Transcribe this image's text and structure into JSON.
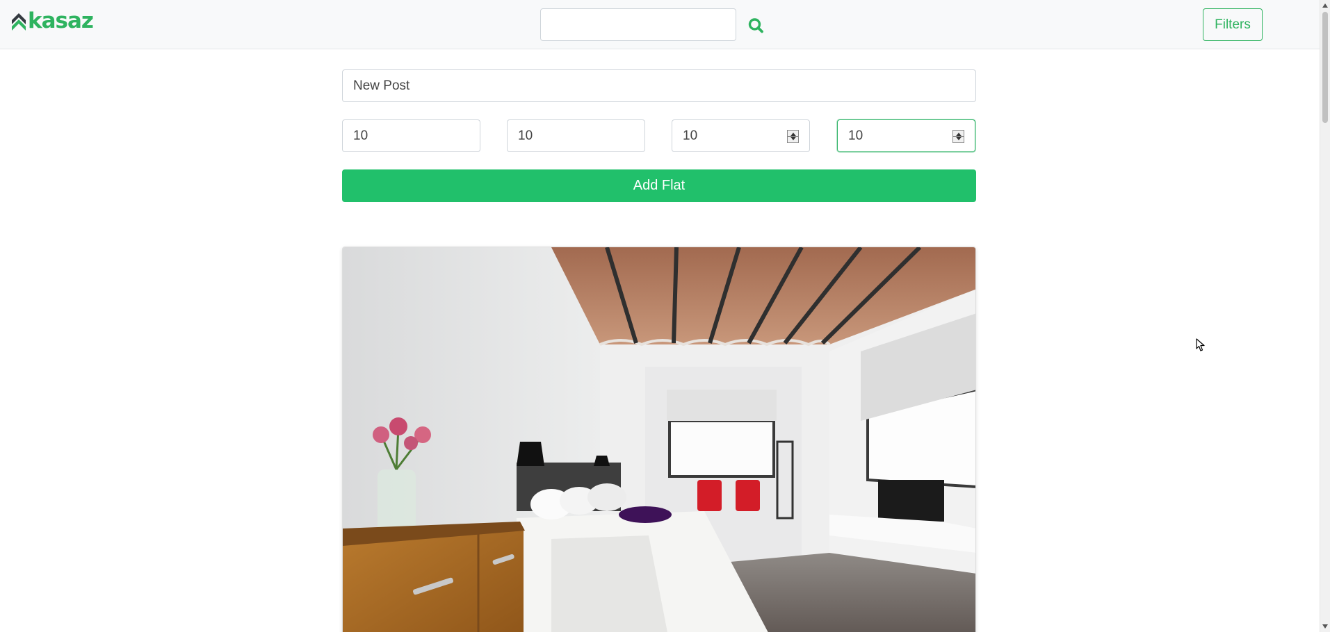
{
  "app": {
    "logo_text": "kasaz",
    "brand_color": "#2eb35f",
    "dark_accent": "#343a40"
  },
  "navbar": {
    "search_value": "",
    "search_icon": "search-icon",
    "filters_label": "Filters"
  },
  "form": {
    "title_value": "New Post",
    "fields": [
      {
        "value": "10",
        "spinner": false
      },
      {
        "value": "10",
        "spinner": false
      },
      {
        "value": "10",
        "spinner": true
      },
      {
        "value": "10",
        "spinner": true,
        "focused": true
      }
    ],
    "add_button_label": "Add Flat",
    "add_button_color": "#21c06b"
  },
  "listing": {
    "image": "bedroom-photo"
  }
}
